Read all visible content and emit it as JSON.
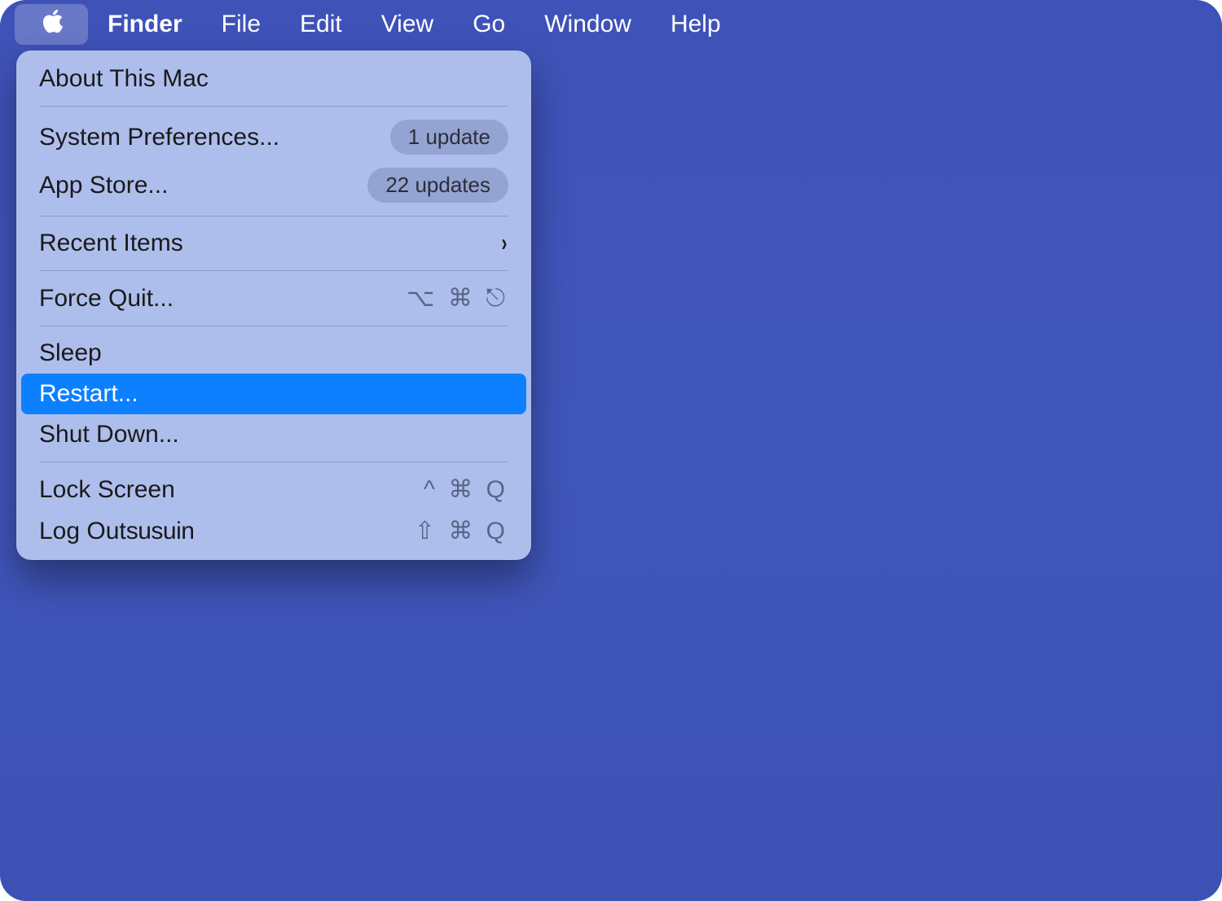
{
  "menubar": {
    "app_name": "Finder",
    "items": [
      "File",
      "Edit",
      "View",
      "Go",
      "Window",
      "Help"
    ]
  },
  "apple_menu": {
    "about": "About This Mac",
    "system_prefs": "System Preferences...",
    "system_prefs_badge": "1 update",
    "app_store": "App Store...",
    "app_store_badge": "22 updates",
    "recent_items": "Recent Items",
    "force_quit": "Force Quit...",
    "force_quit_shortcut": "⌥ ⌘ ⎋",
    "sleep": "Sleep",
    "restart": "Restart...",
    "shut_down": "Shut Down...",
    "lock_screen": "Lock Screen",
    "lock_screen_shortcut": "^ ⌘ Q",
    "log_out_prefix": "Log Out ",
    "log_out_user": "susuin",
    "log_out_shortcut": "⇧ ⌘ Q"
  }
}
